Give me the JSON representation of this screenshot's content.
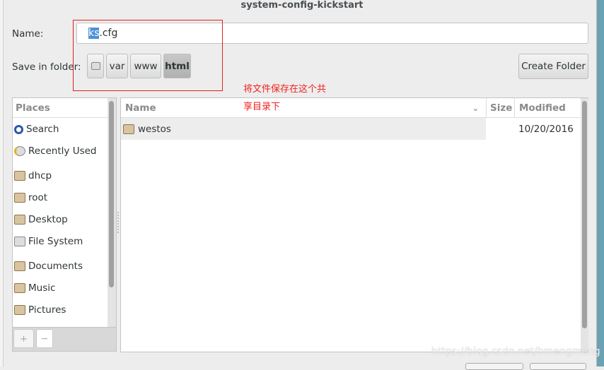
{
  "window": {
    "title": "system-config-kickstart"
  },
  "name_field": {
    "label": "Name:",
    "value_selected": "ks",
    "value_rest": ".cfg"
  },
  "folder": {
    "label": "Save in folder:",
    "path": [
      "var",
      "www",
      "html"
    ],
    "create_label": "Create Folder"
  },
  "annotation": {
    "line1": "将文件保存在这个共",
    "line2": "享目录下",
    "color": "#f02020"
  },
  "places": {
    "header": "Places",
    "items": [
      {
        "label": "Search",
        "icon": "search-icon"
      },
      {
        "label": "Recently Used",
        "icon": "clock-icon"
      },
      {
        "label": "dhcp",
        "icon": "folder-icon"
      },
      {
        "label": "root",
        "icon": "home-folder-icon"
      },
      {
        "label": "Desktop",
        "icon": "desktop-folder-icon"
      },
      {
        "label": "File System",
        "icon": "drive-icon"
      },
      {
        "label": "Documents",
        "icon": "documents-folder-icon"
      },
      {
        "label": "Music",
        "icon": "music-folder-icon"
      },
      {
        "label": "Pictures",
        "icon": "pictures-folder-icon"
      }
    ],
    "add": "+",
    "remove": "—"
  },
  "files": {
    "columns": [
      "Name",
      "Size",
      "Modified"
    ],
    "rows": [
      {
        "name": "westos",
        "size": "",
        "modified": "10/20/2016"
      }
    ]
  },
  "watermark": "https://blog.csdn.net/bmengmeng"
}
